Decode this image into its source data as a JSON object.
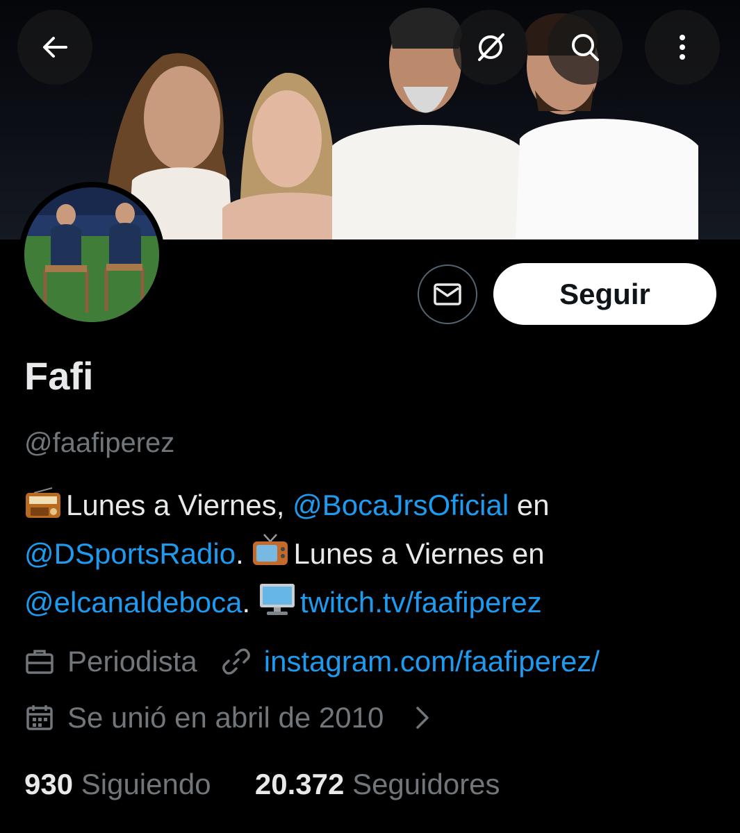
{
  "colors": {
    "accent": "#1d9bf0",
    "background": "#000000",
    "text_primary": "#e7e9ea",
    "text_secondary": "#71767b"
  },
  "header": {
    "back_icon": "arrow-left-icon",
    "grok_icon": "grok-icon",
    "search_icon": "search-icon",
    "more_icon": "more-vertical-icon"
  },
  "actions": {
    "message_icon": "envelope-icon",
    "follow_label": "Seguir"
  },
  "profile": {
    "name": "Fafi",
    "handle": "@faafiperez"
  },
  "bio": {
    "line1": {
      "emoji_icon": "radio-icon",
      "text_a": "Lunes a Viernes, ",
      "mention_1": "@BocaJrsOficial",
      "text_b": " en"
    },
    "line2": {
      "mention_2": "@DSportsRadio",
      "text_c": ". ",
      "emoji_icon": "tv-icon",
      "text_d": "Lunes a Viernes en"
    },
    "line3": {
      "mention_3": "@elcanaldeboca",
      "text_e": ". ",
      "emoji_icon": "desktop-icon",
      "link": "twitch.tv/faafiperez"
    }
  },
  "meta": {
    "profession_icon": "briefcase-icon",
    "profession": "Periodista",
    "link_icon": "link-icon",
    "website": "instagram.com/faafiperez/",
    "calendar_icon": "calendar-icon",
    "joined": "Se unió en abril de 2010",
    "chevron_icon": "chevron-right-icon"
  },
  "stats": {
    "following_count": "930",
    "following_label": "Siguiendo",
    "followers_count": "20.372",
    "followers_label": "Seguidores"
  }
}
